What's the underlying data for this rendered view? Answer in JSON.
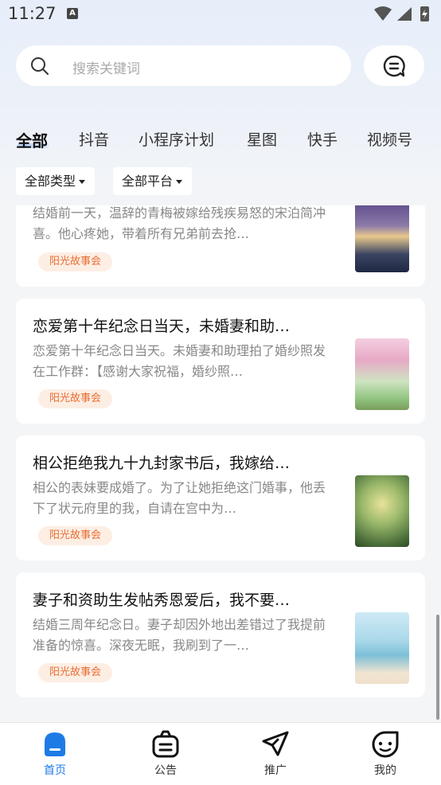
{
  "status_bar": {
    "time": "11:27",
    "notification_glyph": "A"
  },
  "search": {
    "placeholder": "搜索关键词"
  },
  "tabs": [
    {
      "label": "全部",
      "active": true
    },
    {
      "label": "抖音"
    },
    {
      "label": "小程序计划"
    },
    {
      "label": "星图"
    },
    {
      "label": "快手"
    },
    {
      "label": "视频号"
    }
  ],
  "filters": {
    "type_label": "全部类型",
    "platform_label": "全部平台"
  },
  "cards": [
    {
      "title": "",
      "description": "结婚前一天，温辞的青梅被嫁给残疾易怒的宋泊简冲喜。他心疼她，带着所有兄弟前去抢…",
      "tag": "阳光故事会"
    },
    {
      "title": "恋爱第十年纪念日当天，未婚妻和助…",
      "description": "恋爱第十年纪念日当天。未婚妻和助理拍了婚纱照发在工作群：【感谢大家祝福，婚纱照…",
      "tag": "阳光故事会"
    },
    {
      "title": "相公拒绝我九十九封家书后，我嫁给…",
      "description": "相公的表妹要成婚了。为了让她拒绝这门婚事，他丢下了状元府里的我，自请在宫中为…",
      "tag": "阳光故事会"
    },
    {
      "title": "妻子和资助生发帖秀恩爱后，我不要…",
      "description": "结婚三周年纪念日。妻子却因外地出差错过了我提前准备的惊喜。深夜无眠，我刷到了一…",
      "tag": "阳光故事会"
    }
  ],
  "bottom_nav": [
    {
      "label": "首页",
      "icon": "home-icon",
      "active": true
    },
    {
      "label": "公告",
      "icon": "announcement-icon"
    },
    {
      "label": "推广",
      "icon": "promote-icon"
    },
    {
      "label": "我的",
      "icon": "profile-icon"
    }
  ],
  "colors": {
    "accent": "#1e7be6",
    "tag_text": "#ea6d32",
    "tag_bg": "#fdeee4"
  }
}
